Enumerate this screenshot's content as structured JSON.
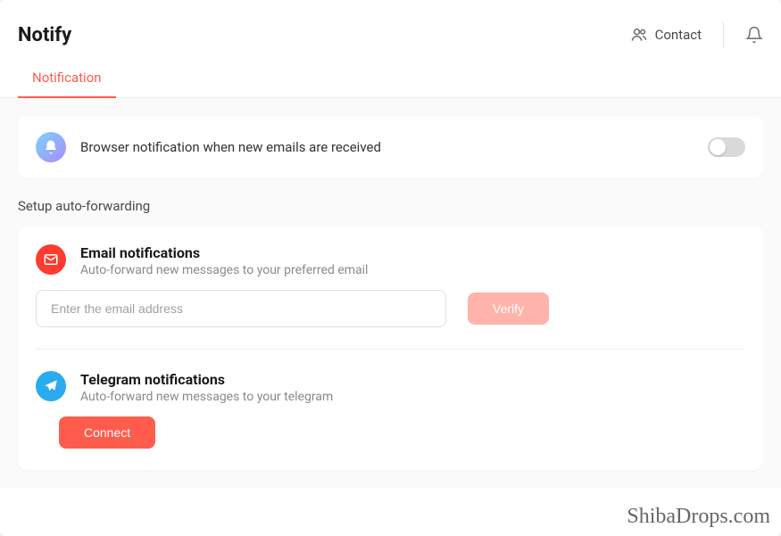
{
  "header": {
    "title": "Notify",
    "contact_label": "Contact"
  },
  "tabs": {
    "notification_label": "Notification"
  },
  "browser_notif": {
    "text": "Browser notification when new emails are received",
    "enabled": false
  },
  "section_label": "Setup auto-forwarding",
  "email_notif": {
    "title": "Email notifications",
    "subtitle": "Auto-forward new messages to your preferred email",
    "placeholder": "Enter the email address",
    "verify_label": "Verify"
  },
  "telegram_notif": {
    "title": "Telegram notifications",
    "subtitle": "Auto-forward new messages to your telegram",
    "connect_label": "Connect"
  },
  "watermark": "ShibaDrops.com"
}
